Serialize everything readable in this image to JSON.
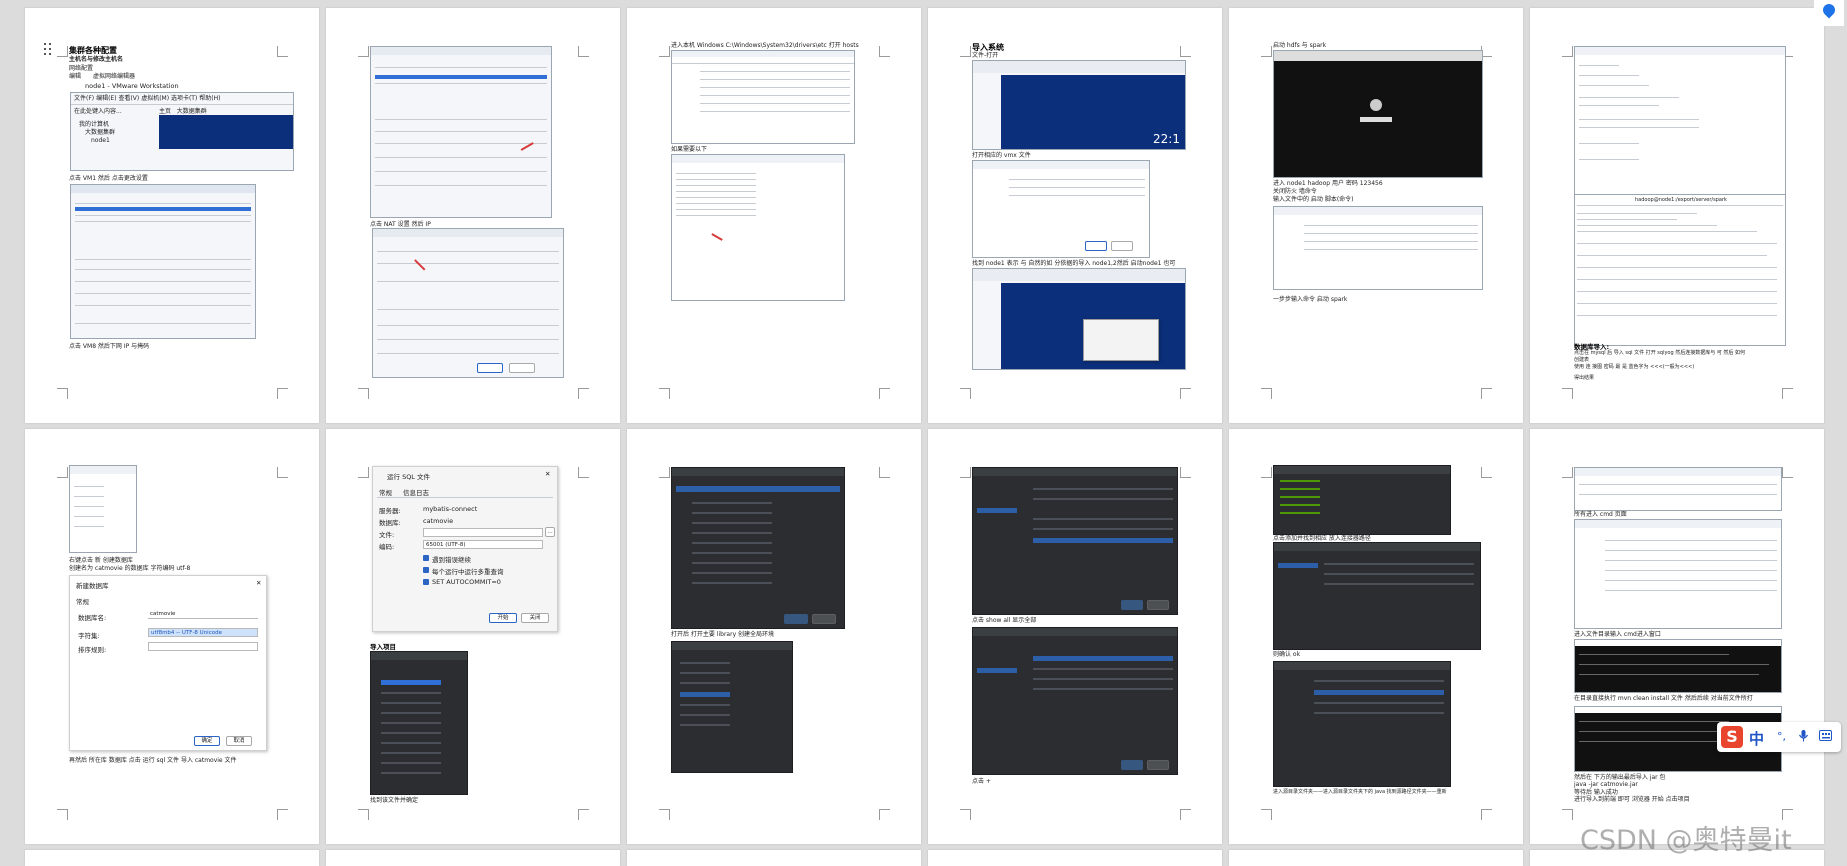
{
  "pages": {
    "p1": {
      "title": "集群各种配置",
      "subtitle": "主机名与修改主机名",
      "line1": "网络配置",
      "line2": "编辑",
      "line2b": "虚拟网络编辑器",
      "vm_title": "node1 - VMware Workstation",
      "vm_menu": [
        "文件(F)",
        "编辑(E)",
        "查看(V)",
        "虚拟机(M)",
        "选项卡(T)",
        "帮助(H)"
      ],
      "vm_tabs": [
        "主页",
        "大数据集群"
      ],
      "vm_tree": [
        "我的计算机",
        "大数据集群",
        "node1"
      ],
      "vm_search": "在此处键入内容...",
      "cap1": "点击 VM1 然后 点击更改设置",
      "cap2": "点击 VM8 然后下网 IP 与掩码"
    },
    "p2": {
      "cap1": "点击 NAT 设置 然后 IP"
    },
    "p3": {
      "cap1": "进入本机 Windows C:\\Windows\\System32\\drivers\\etc 打开 hosts",
      "cap2": "如果需要以下"
    },
    "p4": {
      "title": "导入系统",
      "line1": "文件-打开",
      "cap1": "打开相应的 vmx 文件",
      "cap2": "找到 node1 表示 与 自然的如 分依据的导入 node1,2然后 启动node1 也可"
    },
    "p5": {
      "line1": "启动 hdfs 与 spark",
      "cap1": "进入 node1 hadoop 用户 密码 123456",
      "cap2": "关闭防火 墙命令",
      "cap3": "输入文件中的 启动 脚本(命令)",
      "cap4": "一步步输入命令 启动 spark"
    },
    "p6": {
      "cmd_title": "hadoop@node1:/export/server/spark",
      "heading": "数据库导入:",
      "line1": "点击在 mysql 后 导入 sql 文件 打开 sqlyog 然后连接数据库与 可 然后 如何",
      "line2": "创建表",
      "line3": "使用 连 接图 密码 最 是 蓝色字为 <<<(一般为<<<)",
      "line4": "得出结果"
    },
    "p7": {
      "cap1": "右键点击 新 创建数据库",
      "cap2": "创建名为 catmovie 的数据库 字符编码 utf-8",
      "dlg_title": "新建数据库",
      "dlg_group": "常规",
      "lbl_name": "数据库名:",
      "val_name": "catmovie",
      "lbl_charset": "字符集:",
      "val_charset": "utf8mb4 -- UTF-8 Unicode",
      "lbl_collation": "排序规则:",
      "btn_ok": "确定",
      "btn_cancel": "取消",
      "cap3": "再然后 所在库 数据库 点击 运行 sql 文件 导入 catmovie 文件"
    },
    "p8": {
      "dlg_title": "运行 SQL 文件",
      "tabs": [
        "常规",
        "信息日志"
      ],
      "lbl_server": "服务器:",
      "val_server": "mybatis-connect",
      "lbl_db": "数据库:",
      "val_db": "catmovie",
      "lbl_file": "文件:",
      "lbl_enc": "编码:",
      "val_enc": "65001 (UTF-8)",
      "opt1": "遇到错误继续",
      "opt2": "每个运行中运行多重查询",
      "opt3": "SET AUTOCOMMIT=0",
      "btn_start": "开始",
      "btn_close": "关闭",
      "heading": "导入项目",
      "cap1": "找到该文件并确定"
    },
    "p9": {
      "cap1": "打开后 打开主要 library 创建全局环境"
    },
    "p10": {
      "cap1": "点击 show all 显示全部",
      "cap2": "点击 +"
    },
    "p11": {
      "cap1": "点击添加并找到相应 放入连接器路径",
      "cap2": "则确认 ok",
      "cap3": "进入源目录文件夹——进入源目录文件夹下的 java 找到源路径文件夹——重新"
    },
    "p12": {
      "cap1": "所有进入 cmd 页面",
      "cap2": "进入文件目录输入 cmd进入窗口",
      "cap3": "在目录直接执行 mvn clean install 文件 然后后续 对当前文件所打",
      "cap4": "然后在 下方的输出最后导入 jar 包",
      "cap5": "java -jar catmovie.jar",
      "cap6": "等待后 输入成功",
      "cap7": "进行导入到前端 即可 浏览器 开始 点击项目"
    }
  },
  "ime": {
    "logo": "S",
    "mode": "中",
    "icons": [
      "°,",
      "mic-icon",
      "keyboard-icon"
    ]
  },
  "watermark": "CSDN @奥特曼it"
}
